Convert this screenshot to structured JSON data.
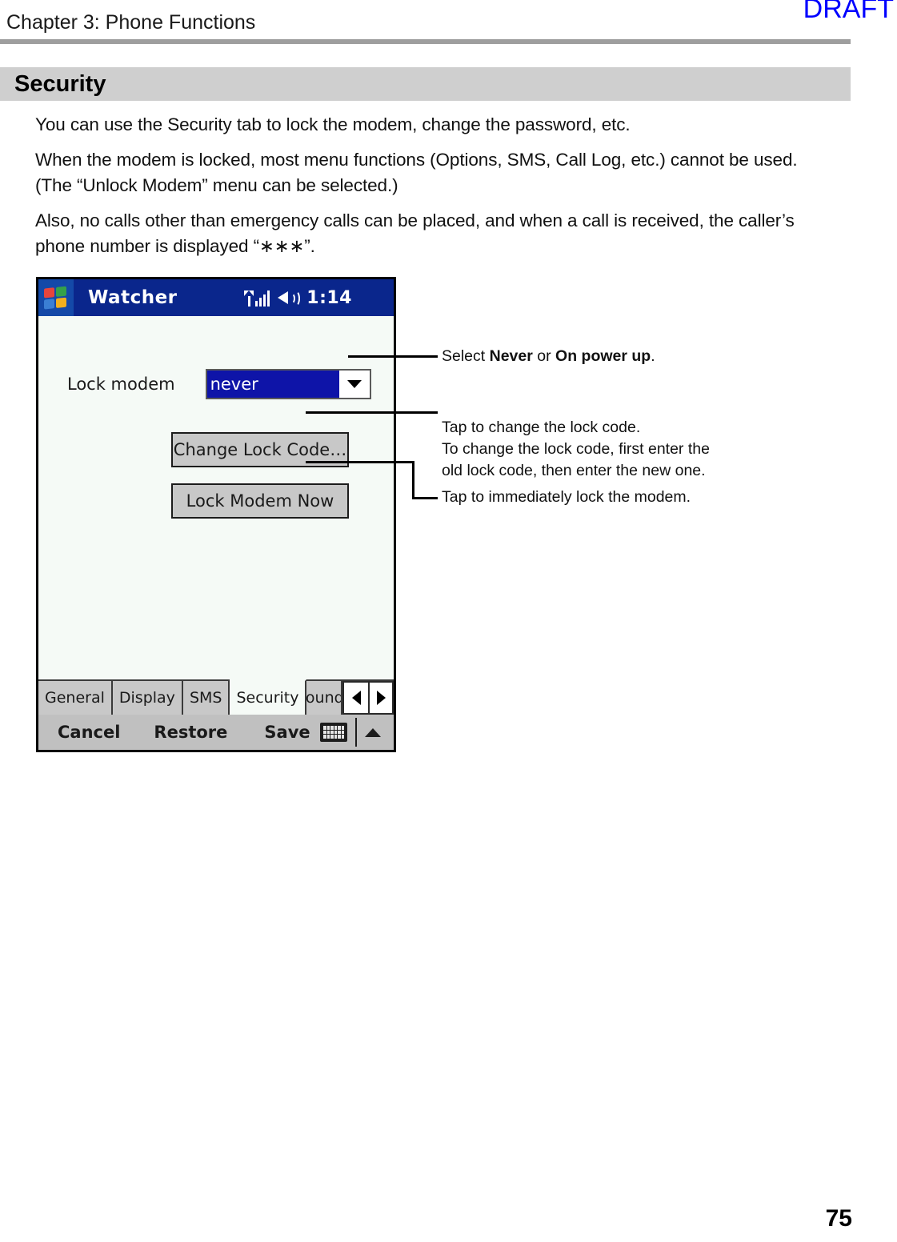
{
  "page": {
    "watermark": "DRAFT",
    "chapter_title": "Chapter 3: Phone Functions",
    "section_title": "Security",
    "page_number": "75"
  },
  "body": {
    "paragraphs": [
      "You can use the Security tab to lock the modem, change the password, etc.",
      "When the modem is locked, most menu functions (Options, SMS, Call Log, etc.) cannot be used. (The “Unlock Modem” menu can be selected.)",
      "Also, no calls other than emergency calls can be placed, and when a call is received, the caller’s phone number is displayed “∗∗∗”."
    ]
  },
  "pda": {
    "titlebar": {
      "start_icon": "windows-flag-icon",
      "app_title": "Watcher",
      "signal_icon": "signal-strength-icon",
      "speaker_icon": "speaker-icon",
      "clock": "1:14",
      "background_color": "#0a268c"
    },
    "form": {
      "lock_modem_label": "Lock modem",
      "lock_modem_value": "never",
      "lock_modem_options": [
        "never",
        "on power up"
      ],
      "dropdown_icon": "chevron-down-icon",
      "selection_color": "#0e14a8"
    },
    "buttons": {
      "change_lock_code": "Change Lock Code…",
      "lock_modem_now": "Lock Modem Now"
    },
    "tabs": {
      "items": [
        "General",
        "Display",
        "SMS",
        "Security",
        "Sounds"
      ],
      "active": "Security",
      "scroll_left_icon": "triangle-left-icon",
      "scroll_right_icon": "triangle-right-icon"
    },
    "commandbar": {
      "cancel": "Cancel",
      "restore": "Restore",
      "save": "Save",
      "keyboard_icon": "keyboard-icon",
      "expand_icon": "triangle-up-icon"
    }
  },
  "callouts": [
    {
      "id": "select-never-callout",
      "prefix": "Select ",
      "bold1": "Never",
      "middle": " or ",
      "bold2": "On power up",
      "suffix": "."
    },
    {
      "id": "change-lock-code-callout",
      "text": "Tap to change the lock code.\nTo change the lock code, first enter the\nold lock code, then enter the new one."
    },
    {
      "id": "lock-modem-now-callout",
      "text": "Tap to immediately lock the modem."
    }
  ]
}
